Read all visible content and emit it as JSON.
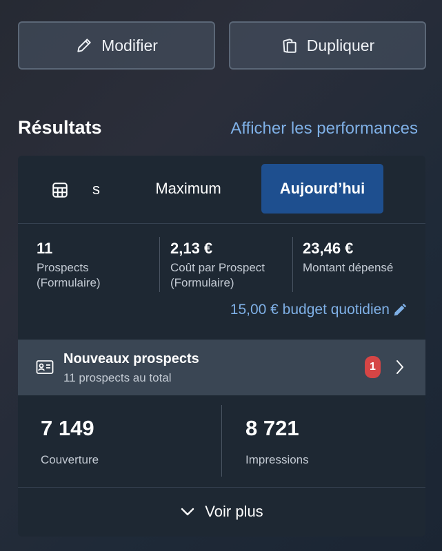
{
  "actions": {
    "edit_label": "Modifier",
    "duplicate_label": "Dupliquer"
  },
  "results": {
    "title": "Résultats",
    "performance_link": "Afficher les performances"
  },
  "tabs": {
    "partial_label": "s",
    "maximum": "Maximum",
    "today": "Aujourd’hui"
  },
  "metrics": [
    {
      "value": "11",
      "label_line1": "Prospects",
      "label_line2": "(Formulaire)"
    },
    {
      "value": "2,13 €",
      "label_line1": "Coût par Prospect",
      "label_line2": "(Formulaire)"
    },
    {
      "value": "23,46 €",
      "label_line1": "Montant dépensé",
      "label_line2": ""
    }
  ],
  "budget": {
    "text": "15,00 € budget quotidien"
  },
  "prospects": {
    "title": "Nouveaux prospects",
    "subtitle": "11 prospects au total",
    "badge": "1"
  },
  "reach": [
    {
      "value": "7 149",
      "label": "Couverture"
    },
    {
      "value": "8 721",
      "label": "Impressions"
    }
  ],
  "more": {
    "label": "Voir plus"
  },
  "colors": {
    "accent": "#1e4f8f",
    "link": "#7fb0e6",
    "badge": "#d64545"
  },
  "icons": [
    "pencil-icon",
    "duplicate-icon",
    "table-icon",
    "id-card-icon",
    "chevron-right-icon",
    "chevron-down-icon"
  ]
}
